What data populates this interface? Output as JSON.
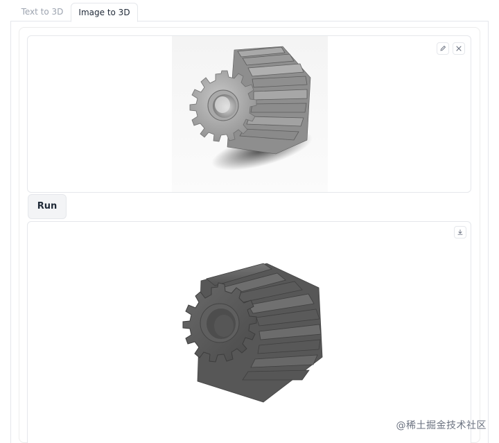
{
  "tabs": {
    "text_to_3d": "Text to 3D",
    "image_to_3d": "Image to 3D",
    "active": "Image to 3D"
  },
  "input_image": {
    "subject": "spur gear (rendered image)",
    "edit_icon": "pencil-icon",
    "clear_icon": "close-icon"
  },
  "run_button": {
    "label": "Run"
  },
  "output_model": {
    "subject": "generated 3D spur gear model",
    "download_icon": "download-icon"
  },
  "watermark": {
    "text": "@稀土掘金技术社区"
  },
  "colors": {
    "border": "#e5e7eb",
    "button_bg": "#f3f4f6",
    "gear_gray": "#6b6b6b",
    "model_gray": "#5a5a5a"
  }
}
